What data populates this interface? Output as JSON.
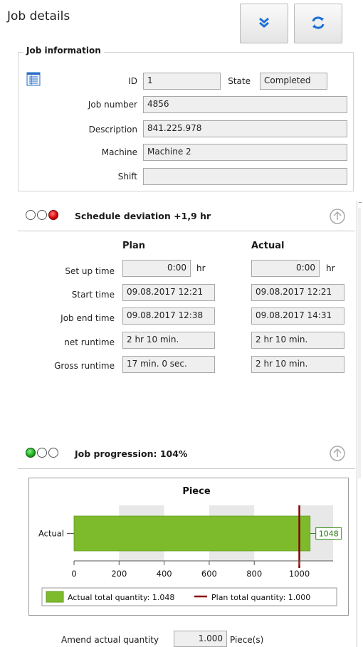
{
  "header": {
    "title": "Job details"
  },
  "job_info": {
    "group_label": "Job information",
    "id_label": "ID",
    "id_value": "1",
    "state_label": "State",
    "state_value": "Completed",
    "job_number_label": "Job number",
    "job_number_value": "4856",
    "description_label": "Description",
    "description_value": "841.225.978",
    "machine_label": "Machine",
    "machine_value": "Machine 2",
    "shift_label": "Shift",
    "shift_value": ""
  },
  "schedule": {
    "title": "Schedule deviation +1,9 hr",
    "lights": [
      "off",
      "off",
      "red"
    ],
    "plan_header": "Plan",
    "actual_header": "Actual",
    "rows": [
      {
        "label": "Set up time",
        "plan": "0:00",
        "plan_unit": "hr",
        "actual": "0:00",
        "actual_unit": "hr"
      },
      {
        "label": "Start time",
        "plan": "09.08.2017 12:21",
        "actual": "09.08.2017 12:21"
      },
      {
        "label": "Job end time",
        "plan": "09.08.2017 12:38",
        "actual": "09.08.2017 14:31"
      },
      {
        "label": "net runtime",
        "plan": "2 hr 10 min.",
        "actual": "2 hr 10 min."
      },
      {
        "label": "Gross runtime",
        "plan": "17 min. 0 sec.",
        "actual": "2 hr 10 min."
      }
    ]
  },
  "progression": {
    "title": "Job progression: 104%",
    "lights": [
      "green",
      "off",
      "off"
    ]
  },
  "chart_data": {
    "type": "bar",
    "orientation": "horizontal",
    "title": "Piece",
    "categories": [
      "Actual"
    ],
    "series": [
      {
        "name": "Actual total quantity: 1.048",
        "values": [
          1048
        ],
        "color": "#7dbb2c"
      }
    ],
    "reference_lines": [
      {
        "name": "Plan total quantity: 1.000",
        "value": 1000,
        "color": "#8b0000"
      }
    ],
    "data_labels": [
      "1048"
    ],
    "xlim": [
      0,
      1150
    ],
    "xticks": [
      0,
      200,
      400,
      600,
      800,
      1000
    ],
    "xtick_labels": [
      "0",
      "200",
      "400",
      "600",
      "800",
      "1000"
    ],
    "legend_position": "bottom",
    "alternating_band_color": "#e8e8e8"
  },
  "amend": {
    "label": "Amend actual quantity",
    "value": "1.000",
    "unit": "Piece(s)"
  },
  "colors": {
    "red_light": "#d40000",
    "green_light": "#1aa81a",
    "bar": "#7dbb2c",
    "plan_line": "#8b0000"
  },
  "icons": {
    "expand": "double-chevron-down-icon",
    "refresh": "refresh-arrows-icon",
    "info": "document-list-icon",
    "collapse": "circle-arrow-up-icon"
  }
}
